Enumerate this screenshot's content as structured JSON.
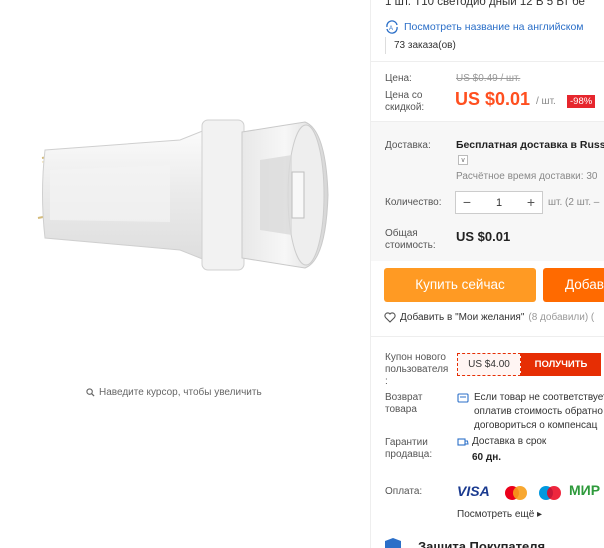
{
  "image_panel": {
    "zoom_hint": "Наведите курсор, чтобы увеличить"
  },
  "product": {
    "title": "1 шт. T10 светодио дный 12 В 5 Вт бе",
    "translate_link": "Посмотреть название на английском",
    "orders": "73 заказа(ов)"
  },
  "price": {
    "label": "Цена:",
    "old_value": "US $0.49 / шт.",
    "discount_label": "Цена со скидкой:",
    "new_value": "US $0.01",
    "unit": "/ шт.",
    "discount_badge": "-98%"
  },
  "shipping": {
    "label": "Доставка:",
    "method": "Бесплатная доставка в Russia",
    "estimate": "Расчётное время доставки: 30"
  },
  "quantity": {
    "label": "Количество:",
    "minus": "−",
    "value": "1",
    "plus": "+",
    "stock": "шт. (2 шт. –"
  },
  "total": {
    "label": "Общая стоимость:",
    "value": "US $0.01"
  },
  "actions": {
    "buy_now": "Купить сейчас",
    "add_to_cart": "Добав"
  },
  "wishlist": {
    "label": "Добавить в \"Мои желания\"",
    "count": "(8 добавили) ("
  },
  "coupon": {
    "label": "Купон нового пользователя :",
    "amount": "US $4.00",
    "get_button": "ПОЛУЧИТЬ"
  },
  "returns": {
    "label": "Возврат товара",
    "text_line1": "Если товар не соответствует",
    "text_line2": "оплатив стоимость обратно",
    "text_line3": "договориться о компенсац"
  },
  "seller_guarantee": {
    "label": "Гарантии продавца:",
    "text": "Доставка в срок",
    "days": "60 дн."
  },
  "payment": {
    "label": "Оплата:",
    "visa": "VISA",
    "mir": "МИР",
    "see_more": "Посмотреть ещё ▸"
  },
  "protection": {
    "title": "Защита Покупателя"
  },
  "colors": {
    "accent_orange": "#ff9a23",
    "cart_orange": "#ff6a00",
    "price_red": "#ff4f1f",
    "badge_red": "#e6262d",
    "link_blue": "#2b6fc8"
  }
}
